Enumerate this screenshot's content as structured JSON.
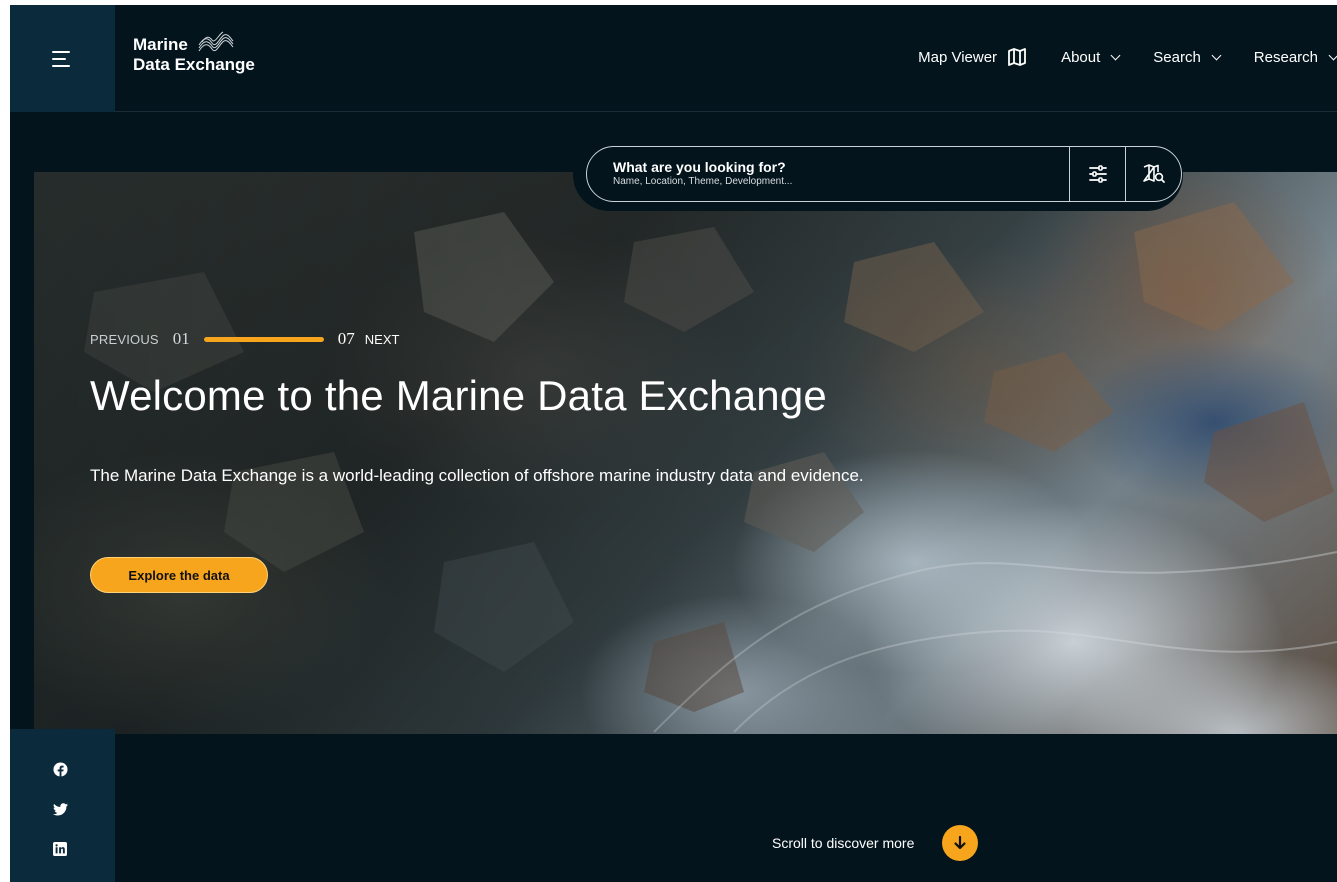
{
  "header": {
    "menu_icon": "hamburger-menu-icon",
    "logo_line1": "Marine",
    "logo_line2": "Data Exchange"
  },
  "nav": {
    "items": [
      {
        "label": "Map Viewer",
        "icon": "map-icon"
      },
      {
        "label": "About",
        "icon": "chevron-down-icon"
      },
      {
        "label": "Search",
        "icon": "chevron-down-icon"
      },
      {
        "label": "Research",
        "icon": "chevron-down-icon"
      }
    ]
  },
  "search": {
    "label": "What are you looking for?",
    "placeholder": "Name, Location, Theme, Development...",
    "filter_icon": "sliders-icon",
    "map_search_icon": "map-search-icon"
  },
  "hero": {
    "pager": {
      "previous": "PREVIOUS",
      "current": "01",
      "total": "07",
      "next": "NEXT",
      "progress": 1.0
    },
    "title": "Welcome to the Marine Data Exchange",
    "text": "The Marine Data Exchange is a world-leading collection of offshore marine industry data and evidence.",
    "button": "Explore the data"
  },
  "social": {
    "items": [
      "facebook-icon",
      "twitter-icon",
      "linkedin-icon"
    ]
  },
  "scroll": {
    "label": "Scroll to discover more",
    "icon": "arrow-down-icon"
  },
  "colors": {
    "background": "#03141c",
    "panel": "#0b2a3b",
    "accent": "#f7a51c"
  }
}
